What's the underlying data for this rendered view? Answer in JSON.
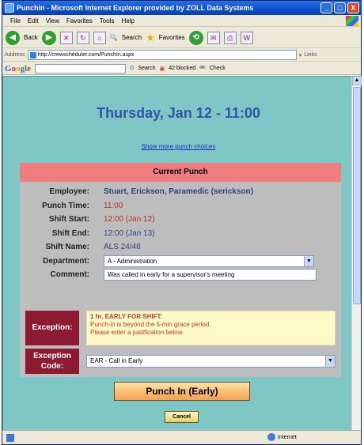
{
  "window": {
    "title": "Punchin - Microsoft Internet Explorer provided by ZOLL Data Systems",
    "buttons": [
      "_",
      "□",
      "X"
    ]
  },
  "menu": [
    "File",
    "Edit",
    "View",
    "Favorites",
    "Tools",
    "Help"
  ],
  "toolbar": {
    "back_label": "Back",
    "search_label": "Search",
    "favorites_label": "Favorites"
  },
  "address": {
    "label": "Address",
    "url": "http://crewscheduler.com/PunchIn.aspx",
    "links_label": "Links"
  },
  "google_bar": {
    "logo": "Google",
    "search_label": "Search",
    "blocked_label": "42 blocked",
    "check_label": "Check"
  },
  "page": {
    "heading": "Thursday, Jan 12 - 11:00",
    "more_link": "Show more punch choices",
    "panel_title": "Current Punch",
    "fields": {
      "employee_label": "Employee:",
      "employee_value": "Stuart, Erickson, Paramedic (serickson)",
      "punch_time_label": "Punch Time:",
      "punch_time_value": "11:00",
      "shift_start_label": "Shift Start:",
      "shift_start_value": "12:00 (Jan 12)",
      "shift_end_label": "Shift End:",
      "shift_end_value": "12:00 (Jan 13)",
      "shift_name_label": "Shift Name:",
      "shift_name_value": "ALS 24/48",
      "department_label": "Department:",
      "department_value": "A - Administration",
      "comment_label": "Comment:",
      "comment_value": "Was called in early for a supervisor's meeting"
    },
    "exception": {
      "label": "Exception:",
      "title": "1 hr. EARLY FOR SHIFT:",
      "line1": "Punch-in is beyond the 5-min grace period.",
      "line2": "Please enter a justification below.",
      "code_label_1": "Exception",
      "code_label_2": "Code:",
      "code_value": "EAR - Call in Early"
    },
    "punch_button": "Punch In (Early)",
    "cancel_button": "Cancel"
  },
  "status": {
    "zone": "Internet"
  },
  "colors": {
    "page_bg": "#7fc7c6",
    "heading": "#2d55a8",
    "panel_header": "#f07d7d",
    "exception_label": "#8e1a32",
    "exception_text": "#c23b24",
    "punch_button": "#f6a04c"
  }
}
